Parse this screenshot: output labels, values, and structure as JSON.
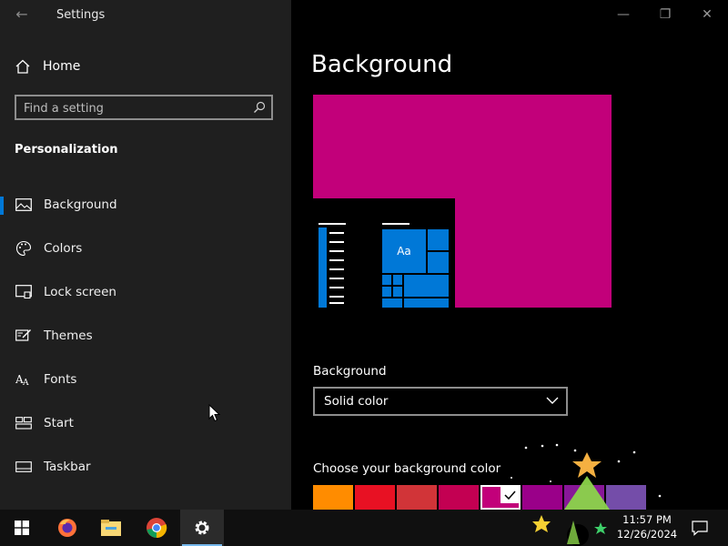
{
  "app": {
    "title": "Settings"
  },
  "sidebar": {
    "home_label": "Home",
    "search_placeholder": "Find a setting",
    "section_title": "Personalization",
    "items": [
      {
        "label": "Background",
        "icon": "picture-icon",
        "active": true
      },
      {
        "label": "Colors",
        "icon": "palette-icon",
        "active": false
      },
      {
        "label": "Lock screen",
        "icon": "lock-screen-icon",
        "active": false
      },
      {
        "label": "Themes",
        "icon": "themes-icon",
        "active": false
      },
      {
        "label": "Fonts",
        "icon": "fonts-icon",
        "active": false
      },
      {
        "label": "Start",
        "icon": "start-icon",
        "active": false
      },
      {
        "label": "Taskbar",
        "icon": "taskbar-icon",
        "active": false
      }
    ]
  },
  "main": {
    "page_title": "Background",
    "preview": {
      "tile_text": "Aa",
      "background_color": "#c2007a"
    },
    "background_label": "Background",
    "background_value": "Solid color",
    "choose_color_label": "Choose your background color",
    "swatches": [
      "#ff8c00",
      "#e81123",
      "#d13438",
      "#c30052",
      "#c2007a",
      "#9a0089",
      "#881798",
      "#744da9"
    ],
    "selected_swatch_index": 4
  },
  "taskbar": {
    "apps": [
      "windows-start-icon",
      "firefox-icon",
      "file-explorer-icon",
      "chrome-icon",
      "settings-gear-icon"
    ],
    "active_app": "settings-gear-icon",
    "time": "11:57 PM",
    "date": "12/26/2024"
  },
  "colors": {
    "accent": "#0078d7",
    "sidebar_bg": "#1f1f1f",
    "main_bg": "#000000"
  }
}
